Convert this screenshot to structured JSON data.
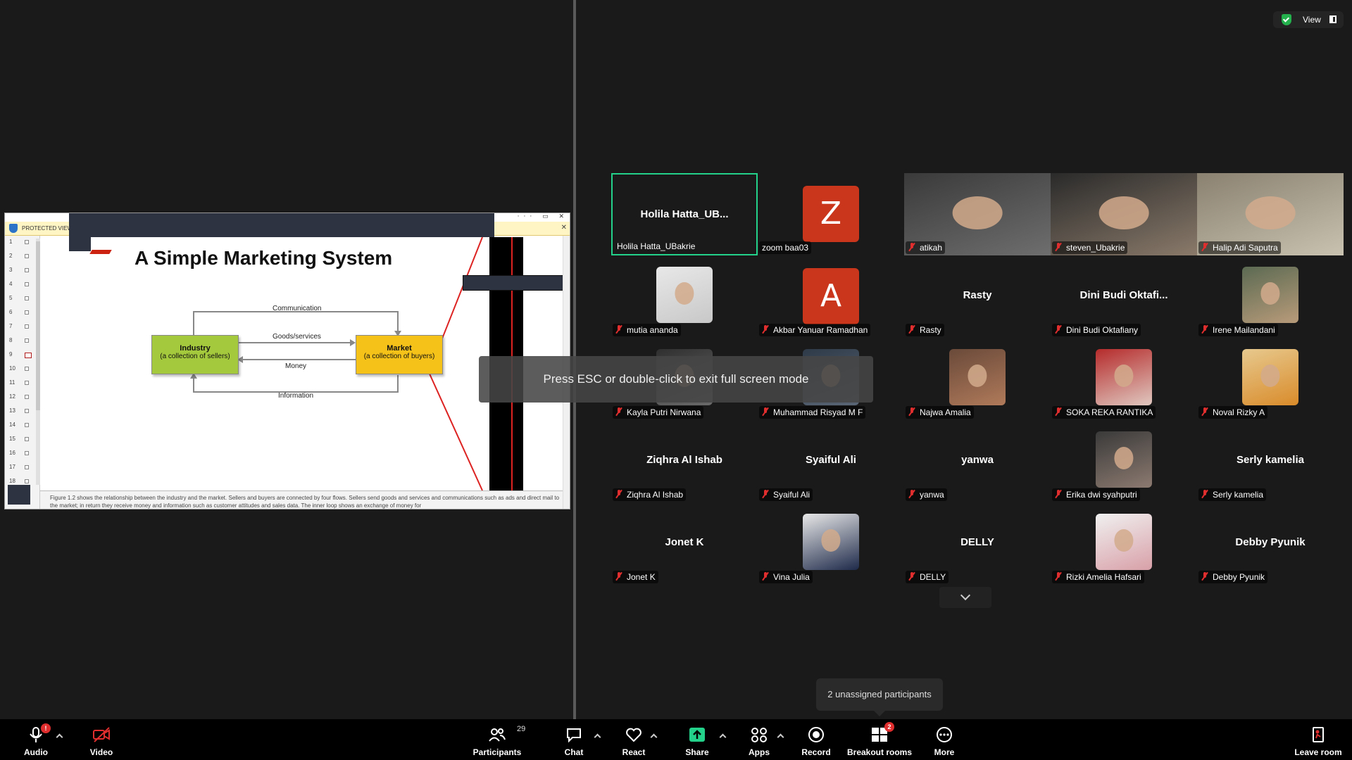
{
  "slide": {
    "protected_view": "PROTECTED VIEW",
    "title": "A Simple Marketing System",
    "thumbnails": [
      "1",
      "2",
      "3",
      "4",
      "5",
      "6",
      "7",
      "8",
      "9",
      "10",
      "11",
      "12",
      "13",
      "14",
      "15",
      "16",
      "17",
      "18"
    ],
    "active_thumbnail": "9",
    "diagram": {
      "industry_title": "Industry",
      "industry_sub": "(a collection of sellers)",
      "market_title": "Market",
      "market_sub": "(a collection of buyers)",
      "communication": "Communication",
      "goods": "Goods/services",
      "money": "Money",
      "information": "Information"
    },
    "notes": "Figure 1.2 shows the relationship between the industry and the market. Sellers and buyers are connected by four flows. Sellers send goods and services and communications such as ads and direct mail to the market; in return they receive money and information such as customer attitudes and sales data. The inner loop shows an exchange of money for"
  },
  "view": {
    "label": "View",
    "accent": "#23b04d"
  },
  "toast": {
    "esc": "Press ESC or double-click to exit full screen mode"
  },
  "breakout_popup": "2 unassigned participants",
  "tiles": [
    {
      "id": "holila",
      "display": "Holila  Hatta_UB...",
      "name": "Holila Hatta_UBakrie",
      "kind": "name",
      "active": true,
      "muted": false
    },
    {
      "id": "zoom-baa03",
      "letter": "Z",
      "name": "zoom baa03",
      "kind": "letter",
      "muted": false
    },
    {
      "id": "atikah",
      "name": "atikah",
      "kind": "video",
      "muted": true
    },
    {
      "id": "steven",
      "name": "steven_Ubakrie",
      "kind": "video",
      "muted": true
    },
    {
      "id": "halip",
      "name": "Halip Adi Saputra",
      "kind": "video",
      "muted": true
    },
    {
      "id": "mutia",
      "name": "mutia ananda",
      "kind": "photo",
      "muted": true
    },
    {
      "id": "akbar",
      "letter": "A",
      "name": "Akbar Yanuar Ramadhan",
      "kind": "letter",
      "muted": true
    },
    {
      "id": "rasty",
      "display": "Rasty",
      "name": "Rasty",
      "kind": "name",
      "muted": true
    },
    {
      "id": "dini",
      "display": "Dini  Budi  Oktafi...",
      "name": "Dini Budi Oktafiany",
      "kind": "name",
      "muted": true
    },
    {
      "id": "irene",
      "name": "Irene Mailandani",
      "kind": "photo",
      "muted": true
    },
    {
      "id": "kayla",
      "name": "Kayla Putri Nirwana",
      "kind": "photo",
      "muted": true
    },
    {
      "id": "risyad",
      "name": "Muhammad Risyad M F",
      "kind": "photo",
      "muted": true
    },
    {
      "id": "najwa",
      "name": "Najwa Amalia",
      "kind": "photo",
      "muted": true
    },
    {
      "id": "soka",
      "name": "SOKA REKA RANTIKA",
      "kind": "photo",
      "muted": true
    },
    {
      "id": "noval",
      "name": "Noval Rizky A",
      "kind": "photo",
      "muted": true
    },
    {
      "id": "ziqhra",
      "display": "Ziqhra Al Ishab",
      "name": "Ziqhra Al Ishab",
      "kind": "name",
      "muted": true
    },
    {
      "id": "syaiful",
      "display": "Syaiful Ali",
      "name": "Syaiful Ali",
      "kind": "name",
      "muted": true
    },
    {
      "id": "yanwa",
      "display": "yanwa",
      "name": "yanwa",
      "kind": "name",
      "muted": true
    },
    {
      "id": "erika",
      "name": "Erika dwi syahputri",
      "kind": "photo",
      "muted": true
    },
    {
      "id": "serly",
      "display": "Serly kamelia",
      "name": "Serly kamelia",
      "kind": "name",
      "muted": true
    },
    {
      "id": "jonet",
      "display": "Jonet K",
      "name": "Jonet K",
      "kind": "name",
      "muted": true
    },
    {
      "id": "vina",
      "name": "Vina Julia",
      "kind": "photo",
      "muted": true
    },
    {
      "id": "delly",
      "display": "DELLY",
      "name": "DELLY",
      "kind": "name",
      "muted": true
    },
    {
      "id": "rizki",
      "name": "Rizki Amelia Hafsari",
      "kind": "photo",
      "muted": true
    },
    {
      "id": "debby",
      "display": "Debby Pyunik",
      "name": "Debby Pyunik",
      "kind": "name",
      "muted": true
    }
  ],
  "toolbar": {
    "audio": "Audio",
    "video": "Video",
    "participants": "Participants",
    "participants_count": "29",
    "chat": "Chat",
    "react": "React",
    "share": "Share",
    "apps": "Apps",
    "record": "Record",
    "breakout": "Breakout rooms",
    "breakout_badge": "2",
    "audio_badge": "!",
    "more": "More",
    "leave": "Leave room",
    "accent_share": "#23d18b",
    "alert_red": "#e02e2e"
  }
}
